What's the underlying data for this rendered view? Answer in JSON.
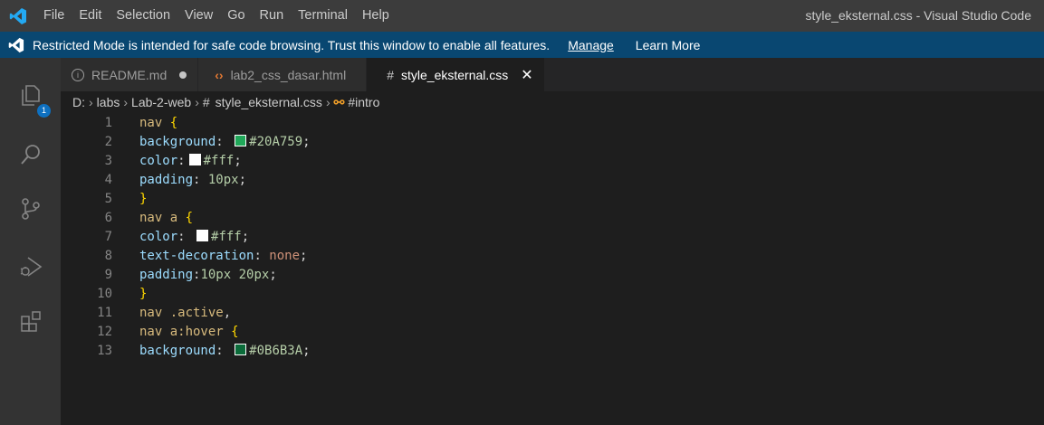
{
  "titlebar": {
    "menu": [
      "File",
      "Edit",
      "Selection",
      "View",
      "Go",
      "Run",
      "Terminal",
      "Help"
    ],
    "window_title": "style_eksternal.css - Visual Studio Code"
  },
  "banner": {
    "message": "Restricted Mode is intended for safe code browsing. Trust this window to enable all features.",
    "manage": "Manage",
    "learn_more": "Learn More"
  },
  "activity": {
    "icons": [
      "explorer-icon",
      "search-icon",
      "source-control-icon",
      "run-debug-icon",
      "extensions-icon"
    ],
    "badge": "1"
  },
  "tabs": [
    {
      "label": "README.md",
      "icon": "info-icon",
      "dirty": true,
      "active": false
    },
    {
      "label": "lab2_css_dasar.html",
      "icon": "html-icon",
      "dirty": false,
      "active": false
    },
    {
      "label": "style_eksternal.css",
      "icon": "css-hash-icon",
      "dirty": false,
      "active": true
    }
  ],
  "breadcrumb": {
    "parts": [
      "D:",
      "labs",
      "Lab-2-web",
      "style_eksternal.css",
      "#intro"
    ]
  },
  "editor": {
    "lines": [
      {
        "n": "1",
        "tokens": [
          [
            "sel",
            "nav"
          ],
          [
            "punc",
            " "
          ],
          [
            "brace",
            "{"
          ]
        ]
      },
      {
        "n": "2",
        "tokens": [
          [
            "prop",
            "background"
          ],
          [
            "punc",
            ": "
          ],
          [
            "swatch",
            "#20A759"
          ],
          [
            "num",
            "#20A759"
          ],
          [
            "punc",
            ";"
          ]
        ]
      },
      {
        "n": "3",
        "tokens": [
          [
            "prop",
            "color"
          ],
          [
            "punc",
            ":"
          ],
          [
            "swatch",
            "#ffffff"
          ],
          [
            "num",
            "#fff"
          ],
          [
            "punc",
            ";"
          ]
        ]
      },
      {
        "n": "4",
        "tokens": [
          [
            "prop",
            "padding"
          ],
          [
            "punc",
            ": "
          ],
          [
            "num",
            "10px"
          ],
          [
            "punc",
            ";"
          ]
        ]
      },
      {
        "n": "5",
        "tokens": [
          [
            "brace",
            "}"
          ]
        ]
      },
      {
        "n": "6",
        "tokens": [
          [
            "sel",
            "nav a"
          ],
          [
            "punc",
            " "
          ],
          [
            "brace",
            "{"
          ]
        ]
      },
      {
        "n": "7",
        "tokens": [
          [
            "prop",
            "color"
          ],
          [
            "punc",
            ": "
          ],
          [
            "swatch",
            "#ffffff"
          ],
          [
            "num",
            "#fff"
          ],
          [
            "punc",
            ";"
          ]
        ]
      },
      {
        "n": "8",
        "tokens": [
          [
            "prop",
            "text-decoration"
          ],
          [
            "punc",
            ": "
          ],
          [
            "val",
            "none"
          ],
          [
            "punc",
            ";"
          ]
        ]
      },
      {
        "n": "9",
        "tokens": [
          [
            "prop",
            "padding"
          ],
          [
            "punc",
            ":"
          ],
          [
            "num",
            "10px 20px"
          ],
          [
            "punc",
            ";"
          ]
        ]
      },
      {
        "n": "10",
        "tokens": [
          [
            "brace",
            "}"
          ]
        ]
      },
      {
        "n": "11",
        "tokens": [
          [
            "sel",
            "nav .active"
          ],
          [
            "punc",
            ","
          ]
        ]
      },
      {
        "n": "12",
        "tokens": [
          [
            "sel",
            "nav a:hover"
          ],
          [
            "punc",
            " "
          ],
          [
            "brace",
            "{"
          ]
        ]
      },
      {
        "n": "13",
        "tokens": [
          [
            "prop",
            "background"
          ],
          [
            "punc",
            ": "
          ],
          [
            "swatch",
            "#0B6B3A"
          ],
          [
            "num",
            "#0B6B3A"
          ],
          [
            "punc",
            ";"
          ]
        ]
      }
    ]
  },
  "colors": {
    "banner_bg": "#094771",
    "activity_badge": "#0e70c0",
    "accent_blue": "#23a9f2"
  }
}
